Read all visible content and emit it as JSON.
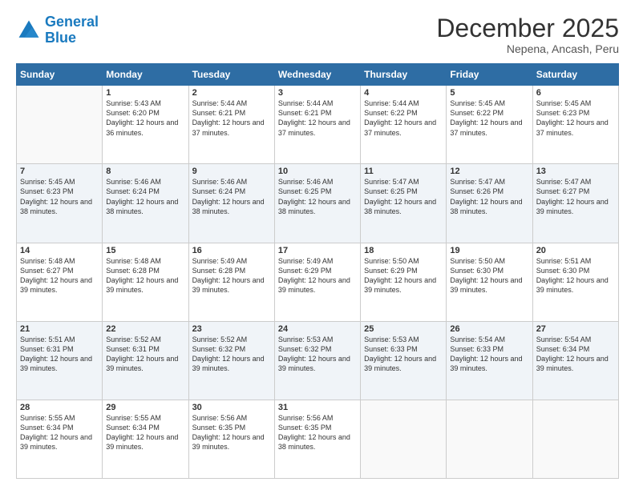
{
  "header": {
    "logo_line1": "General",
    "logo_line2": "Blue",
    "title": "December 2025",
    "subtitle": "Nepena, Ancash, Peru"
  },
  "days_of_week": [
    "Sunday",
    "Monday",
    "Tuesday",
    "Wednesday",
    "Thursday",
    "Friday",
    "Saturday"
  ],
  "weeks": [
    [
      {
        "day": "",
        "sunrise": "",
        "sunset": "",
        "daylight": ""
      },
      {
        "day": "1",
        "sunrise": "Sunrise: 5:43 AM",
        "sunset": "Sunset: 6:20 PM",
        "daylight": "Daylight: 12 hours and 36 minutes."
      },
      {
        "day": "2",
        "sunrise": "Sunrise: 5:44 AM",
        "sunset": "Sunset: 6:21 PM",
        "daylight": "Daylight: 12 hours and 37 minutes."
      },
      {
        "day": "3",
        "sunrise": "Sunrise: 5:44 AM",
        "sunset": "Sunset: 6:21 PM",
        "daylight": "Daylight: 12 hours and 37 minutes."
      },
      {
        "day": "4",
        "sunrise": "Sunrise: 5:44 AM",
        "sunset": "Sunset: 6:22 PM",
        "daylight": "Daylight: 12 hours and 37 minutes."
      },
      {
        "day": "5",
        "sunrise": "Sunrise: 5:45 AM",
        "sunset": "Sunset: 6:22 PM",
        "daylight": "Daylight: 12 hours and 37 minutes."
      },
      {
        "day": "6",
        "sunrise": "Sunrise: 5:45 AM",
        "sunset": "Sunset: 6:23 PM",
        "daylight": "Daylight: 12 hours and 37 minutes."
      }
    ],
    [
      {
        "day": "7",
        "sunrise": "Sunrise: 5:45 AM",
        "sunset": "Sunset: 6:23 PM",
        "daylight": "Daylight: 12 hours and 38 minutes."
      },
      {
        "day": "8",
        "sunrise": "Sunrise: 5:46 AM",
        "sunset": "Sunset: 6:24 PM",
        "daylight": "Daylight: 12 hours and 38 minutes."
      },
      {
        "day": "9",
        "sunrise": "Sunrise: 5:46 AM",
        "sunset": "Sunset: 6:24 PM",
        "daylight": "Daylight: 12 hours and 38 minutes."
      },
      {
        "day": "10",
        "sunrise": "Sunrise: 5:46 AM",
        "sunset": "Sunset: 6:25 PM",
        "daylight": "Daylight: 12 hours and 38 minutes."
      },
      {
        "day": "11",
        "sunrise": "Sunrise: 5:47 AM",
        "sunset": "Sunset: 6:25 PM",
        "daylight": "Daylight: 12 hours and 38 minutes."
      },
      {
        "day": "12",
        "sunrise": "Sunrise: 5:47 AM",
        "sunset": "Sunset: 6:26 PM",
        "daylight": "Daylight: 12 hours and 38 minutes."
      },
      {
        "day": "13",
        "sunrise": "Sunrise: 5:47 AM",
        "sunset": "Sunset: 6:27 PM",
        "daylight": "Daylight: 12 hours and 39 minutes."
      }
    ],
    [
      {
        "day": "14",
        "sunrise": "Sunrise: 5:48 AM",
        "sunset": "Sunset: 6:27 PM",
        "daylight": "Daylight: 12 hours and 39 minutes."
      },
      {
        "day": "15",
        "sunrise": "Sunrise: 5:48 AM",
        "sunset": "Sunset: 6:28 PM",
        "daylight": "Daylight: 12 hours and 39 minutes."
      },
      {
        "day": "16",
        "sunrise": "Sunrise: 5:49 AM",
        "sunset": "Sunset: 6:28 PM",
        "daylight": "Daylight: 12 hours and 39 minutes."
      },
      {
        "day": "17",
        "sunrise": "Sunrise: 5:49 AM",
        "sunset": "Sunset: 6:29 PM",
        "daylight": "Daylight: 12 hours and 39 minutes."
      },
      {
        "day": "18",
        "sunrise": "Sunrise: 5:50 AM",
        "sunset": "Sunset: 6:29 PM",
        "daylight": "Daylight: 12 hours and 39 minutes."
      },
      {
        "day": "19",
        "sunrise": "Sunrise: 5:50 AM",
        "sunset": "Sunset: 6:30 PM",
        "daylight": "Daylight: 12 hours and 39 minutes."
      },
      {
        "day": "20",
        "sunrise": "Sunrise: 5:51 AM",
        "sunset": "Sunset: 6:30 PM",
        "daylight": "Daylight: 12 hours and 39 minutes."
      }
    ],
    [
      {
        "day": "21",
        "sunrise": "Sunrise: 5:51 AM",
        "sunset": "Sunset: 6:31 PM",
        "daylight": "Daylight: 12 hours and 39 minutes."
      },
      {
        "day": "22",
        "sunrise": "Sunrise: 5:52 AM",
        "sunset": "Sunset: 6:31 PM",
        "daylight": "Daylight: 12 hours and 39 minutes."
      },
      {
        "day": "23",
        "sunrise": "Sunrise: 5:52 AM",
        "sunset": "Sunset: 6:32 PM",
        "daylight": "Daylight: 12 hours and 39 minutes."
      },
      {
        "day": "24",
        "sunrise": "Sunrise: 5:53 AM",
        "sunset": "Sunset: 6:32 PM",
        "daylight": "Daylight: 12 hours and 39 minutes."
      },
      {
        "day": "25",
        "sunrise": "Sunrise: 5:53 AM",
        "sunset": "Sunset: 6:33 PM",
        "daylight": "Daylight: 12 hours and 39 minutes."
      },
      {
        "day": "26",
        "sunrise": "Sunrise: 5:54 AM",
        "sunset": "Sunset: 6:33 PM",
        "daylight": "Daylight: 12 hours and 39 minutes."
      },
      {
        "day": "27",
        "sunrise": "Sunrise: 5:54 AM",
        "sunset": "Sunset: 6:34 PM",
        "daylight": "Daylight: 12 hours and 39 minutes."
      }
    ],
    [
      {
        "day": "28",
        "sunrise": "Sunrise: 5:55 AM",
        "sunset": "Sunset: 6:34 PM",
        "daylight": "Daylight: 12 hours and 39 minutes."
      },
      {
        "day": "29",
        "sunrise": "Sunrise: 5:55 AM",
        "sunset": "Sunset: 6:34 PM",
        "daylight": "Daylight: 12 hours and 39 minutes."
      },
      {
        "day": "30",
        "sunrise": "Sunrise: 5:56 AM",
        "sunset": "Sunset: 6:35 PM",
        "daylight": "Daylight: 12 hours and 39 minutes."
      },
      {
        "day": "31",
        "sunrise": "Sunrise: 5:56 AM",
        "sunset": "Sunset: 6:35 PM",
        "daylight": "Daylight: 12 hours and 38 minutes."
      },
      {
        "day": "",
        "sunrise": "",
        "sunset": "",
        "daylight": ""
      },
      {
        "day": "",
        "sunrise": "",
        "sunset": "",
        "daylight": ""
      },
      {
        "day": "",
        "sunrise": "",
        "sunset": "",
        "daylight": ""
      }
    ]
  ]
}
